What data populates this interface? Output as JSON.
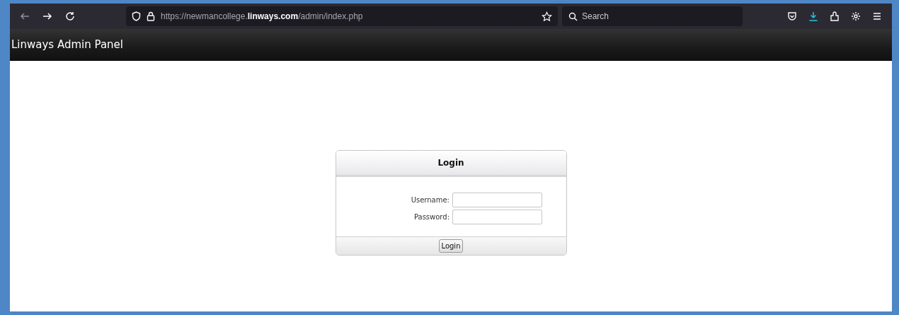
{
  "browser": {
    "url": "https://newmancollege.**linways.com**/admin/index.php",
    "search": {
      "placeholder": "Search"
    }
  },
  "header": {
    "title": "Linways Admin Panel"
  },
  "login": {
    "title": "Login",
    "fields": [
      {
        "label": "Username:"
      },
      {
        "label": "Password:"
      }
    ],
    "button": "Login"
  }
}
